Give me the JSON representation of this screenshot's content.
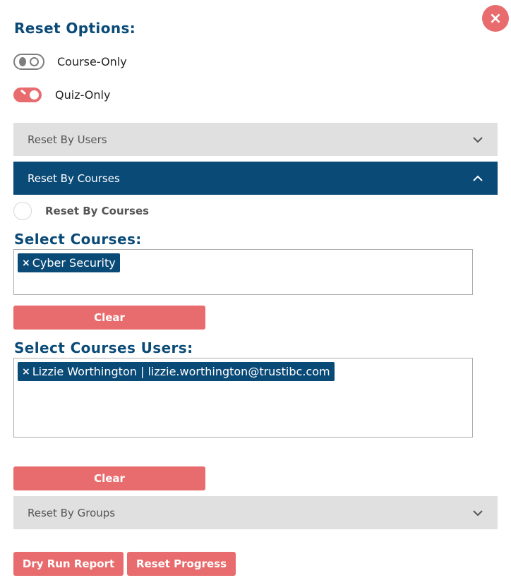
{
  "close_glyph": "×",
  "reset_options_title": "Reset Options:",
  "toggles": {
    "course_only": {
      "label": "Course-Only",
      "state": "off"
    },
    "quiz_only": {
      "label": "Quiz-Only",
      "state": "on"
    }
  },
  "accordions": {
    "users": "Reset By Users",
    "courses": "Reset By Courses",
    "groups": "Reset By Groups"
  },
  "radio": {
    "label": "Reset By Courses"
  },
  "select_courses": {
    "heading": "Select Courses:",
    "chip_remove": "×",
    "chip": "Cyber Security",
    "clear": "Clear"
  },
  "select_users": {
    "heading": "Select Courses Users:",
    "chip_remove": "×",
    "chip": "Lizzie Worthington | lizzie.worthington@trustibc.com",
    "clear": "Clear"
  },
  "actions": {
    "dry_run": "Dry Run Report",
    "reset": "Reset Progress"
  },
  "colors": {
    "primary": "#0a4a77",
    "accent": "#e86c6e",
    "accordion_bg": "#e0e0e0"
  }
}
